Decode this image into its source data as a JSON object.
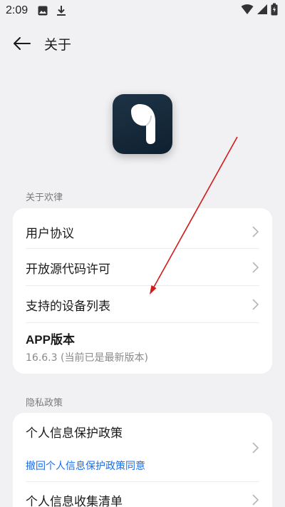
{
  "status_bar": {
    "time": "2:09",
    "left_icons": [
      "image-icon",
      "download-icon"
    ],
    "right_icons": [
      "wifi-icon",
      "signal-icon",
      "battery-icon"
    ]
  },
  "header": {
    "back_icon": "arrow-left-icon",
    "title": "关于"
  },
  "sections": [
    {
      "label": "关于欢律",
      "items": [
        {
          "label": "用户协议"
        },
        {
          "label": "开放源代码许可"
        },
        {
          "label": "支持的设备列表"
        },
        {
          "label": "APP版本",
          "sub": "16.6.3 (当前已是最新版本)"
        }
      ]
    },
    {
      "label": "隐私政策",
      "items": [
        {
          "label": "个人信息保护政策",
          "link": "撤回个人信息保护政策同意"
        },
        {
          "label": "个人信息收集清单"
        }
      ]
    }
  ],
  "colors": {
    "background": "#f1f1f3",
    "card": "#ffffff",
    "link": "#1a6ee8",
    "annotation_arrow": "#d11a1a",
    "logo": "#13283a"
  }
}
